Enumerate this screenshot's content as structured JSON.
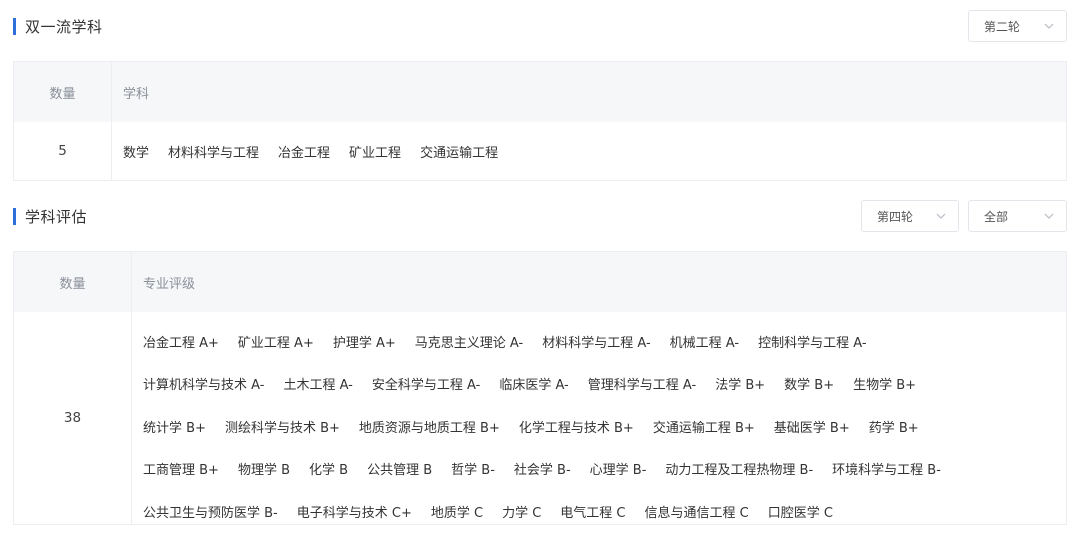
{
  "section1": {
    "title": "双一流学科",
    "round_select": "第二轮",
    "table": {
      "header_count": "数量",
      "header_main": "学科",
      "count": "5",
      "subjects": [
        "数学",
        "材料科学与工程",
        "冶金工程",
        "矿业工程",
        "交通运输工程"
      ]
    }
  },
  "section2": {
    "title": "学科评估",
    "round_select": "第四轮",
    "filter_select": "全部",
    "table": {
      "header_count": "数量",
      "header_main": "专业评级",
      "count": "38",
      "lines": [
        [
          "冶金工程 A+",
          "矿业工程 A+",
          "护理学 A+",
          "马克思主义理论 A-",
          "材料科学与工程 A-",
          "机械工程 A-",
          "控制科学与工程 A-"
        ],
        [
          "计算机科学与技术 A-",
          "土木工程 A-",
          "安全科学与工程 A-",
          "临床医学 A-",
          "管理科学与工程 A-",
          "法学 B+",
          "数学 B+",
          "生物学 B+"
        ],
        [
          "统计学 B+",
          "测绘科学与技术 B+",
          "地质资源与地质工程 B+",
          "化学工程与技术 B+",
          "交通运输工程 B+",
          "基础医学 B+",
          "药学 B+"
        ],
        [
          "工商管理 B+",
          "物理学 B",
          "化学 B",
          "公共管理 B",
          "哲学 B-",
          "社会学 B-",
          "心理学 B-",
          "动力工程及工程热物理 B-",
          "环境科学与工程 B-"
        ],
        [
          "公共卫生与预防医学 B-",
          "电子科学与技术 C+",
          "地质学 C",
          "力学 C",
          "电气工程 C",
          "信息与通信工程 C",
          "口腔医学 C"
        ]
      ]
    }
  },
  "icons": {
    "accent_bar_color": "#2f6fdc",
    "dropdown_icon": "chevron-down-icon"
  }
}
